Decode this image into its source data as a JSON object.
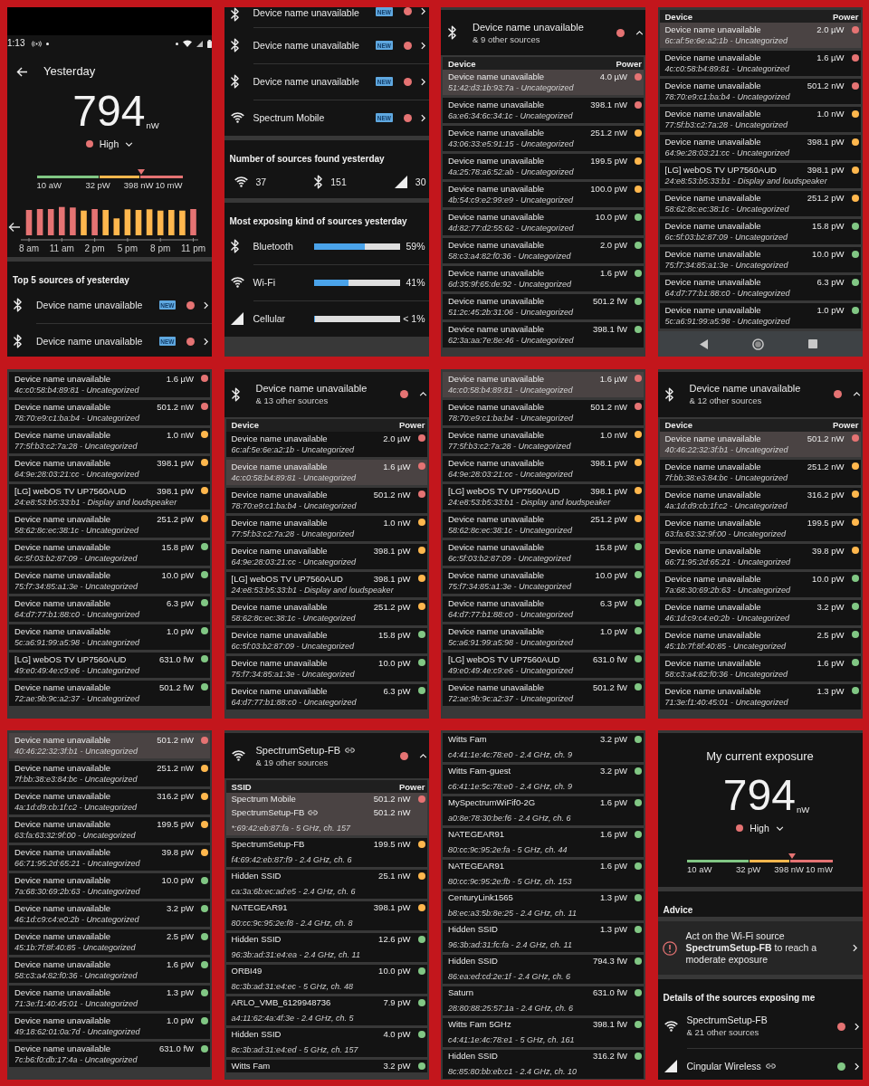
{
  "screens": [
    {
      "blocks": [
        {
          "kind": "status_bar",
          "time": "1:13"
        },
        {
          "kind": "title_bar",
          "title": "Yesterday"
        },
        {
          "kind": "reading",
          "value": "794",
          "unit": "nW",
          "rating": "High",
          "color": "#e57373"
        },
        {
          "kind": "scale",
          "level": 0.72,
          "labels": [
            "10 aW",
            "32 pW",
            "398 nW",
            "10 mW"
          ]
        },
        {
          "kind": "hourly_chart",
          "x_labels": [
            "8 am",
            "11 am",
            "2 pm",
            "5 pm",
            "8 pm",
            "11 pm"
          ]
        },
        {
          "kind": "section_title",
          "text": "Top 5 sources of yesterday"
        },
        {
          "kind": "bluetooth_row",
          "name": "Device name unavailable",
          "badge": "NEW",
          "color": "#e57373"
        },
        {
          "kind": "bluetooth_row",
          "name": "Device name unavailable",
          "badge": "NEW",
          "color": "#e57373"
        }
      ]
    },
    {
      "blocks": [
        {
          "kind": "bluetooth_row",
          "name": "Device name unavailable",
          "badge": "NEW",
          "color": "#e57373"
        },
        {
          "kind": "bluetooth_row",
          "name": "Device name unavailable",
          "badge": "NEW",
          "color": "#e57373"
        },
        {
          "kind": "bluetooth_row",
          "name": "Device name unavailable",
          "badge": "NEW",
          "color": "#e57373"
        },
        {
          "kind": "wifi_row",
          "name": "Spectrum Mobile",
          "badge": "NEW",
          "color": "#e57373"
        },
        {
          "kind": "section_title",
          "text": "Number of sources found yesterday"
        },
        {
          "kind": "counts",
          "items": [
            {
              "kind": "wifi",
              "count": "37"
            },
            {
              "kind": "bluetooth",
              "count": "151"
            },
            {
              "kind": "cellular",
              "count": "30"
            }
          ]
        },
        {
          "kind": "section_title",
          "text": "Most exposing kind of sources yesterday"
        },
        {
          "kind": "bluetooth_share",
          "label": "Bluetooth",
          "level": 0.59,
          "reading": "59%"
        },
        {
          "kind": "wifi_share",
          "label": "Wi-Fi",
          "level": 0.41,
          "reading": "41%"
        },
        {
          "kind": "cellular_share",
          "label": "Cellular",
          "level": 0.01,
          "reading": "< 1%"
        }
      ]
    },
    {
      "blocks": [
        {
          "kind": "bluetooth_group",
          "name": "Device name unavailable",
          "subtitle": "& 9 other sources",
          "color": "#e57373",
          "expanded": true
        },
        {
          "kind": "table_header",
          "columns": [
            "Device",
            "Power"
          ]
        },
        {
          "kind": "device_row",
          "name": "Device name unavailable",
          "power": "4.0 µW",
          "color": "#e57373",
          "detail": "51:42:d3:1b:93:7a - Uncategorized",
          "selected": true
        },
        {
          "kind": "device_row",
          "name": "Device name unavailable",
          "power": "398.1 nW",
          "color": "#e57373",
          "detail": "6a:e6:34:6c:34:1c - Uncategorized",
          "selected": false
        },
        {
          "kind": "device_row",
          "name": "Device name unavailable",
          "power": "251.2 nW",
          "color": "#ffb74d",
          "detail": "43:06:33:e5:91:15 - Uncategorized",
          "selected": false
        },
        {
          "kind": "device_row",
          "name": "Device name unavailable",
          "power": "199.5 pW",
          "color": "#ffb74d",
          "detail": "4a:25:78:a6:52:ab - Uncategorized",
          "selected": false
        },
        {
          "kind": "device_row",
          "name": "Device name unavailable",
          "power": "100.0 pW",
          "color": "#ffb74d",
          "detail": "4b:54:c9:e2:99:e9 - Uncategorized",
          "selected": false
        },
        {
          "kind": "device_row",
          "name": "Device name unavailable",
          "power": "10.0 pW",
          "color": "#81c784",
          "detail": "4d:82:77:d2:55:62 - Uncategorized",
          "selected": false
        },
        {
          "kind": "device_row",
          "name": "Device name unavailable",
          "power": "2.0 pW",
          "color": "#81c784",
          "detail": "58:c3:a4:82:f0:36 - Uncategorized",
          "selected": false
        },
        {
          "kind": "device_row",
          "name": "Device name unavailable",
          "power": "1.6 pW",
          "color": "#81c784",
          "detail": "6d:35:9f:65:de:92 - Uncategorized",
          "selected": false
        },
        {
          "kind": "device_row",
          "name": "Device name unavailable",
          "power": "501.2 fW",
          "color": "#81c784",
          "detail": "51:2c:45:2b:31:06 - Uncategorized",
          "selected": false
        },
        {
          "kind": "device_row",
          "name": "Device name unavailable",
          "power": "398.1 fW",
          "color": "#81c784",
          "detail": "62:3a:aa:7e:8e:46 - Uncategorized",
          "selected": false
        }
      ]
    },
    {
      "blocks": [
        {
          "kind": "table_header",
          "columns": [
            "Device",
            "Power"
          ]
        },
        {
          "kind": "device_row",
          "name": "Device name unavailable",
          "power": "2.0 µW",
          "color": "#e57373",
          "detail": "6c:af:5e:6e:a2:1b - Uncategorized",
          "selected": true
        },
        {
          "kind": "device_row",
          "name": "Device name unavailable",
          "power": "1.6 µW",
          "color": "#e57373",
          "detail": "4c:c0:58:b4:89:81 - Uncategorized",
          "selected": false
        },
        {
          "kind": "device_row",
          "name": "Device name unavailable",
          "power": "501.2 nW",
          "color": "#e57373",
          "detail": "78:70:e9:c1:ba:b4 - Uncategorized",
          "selected": false
        },
        {
          "kind": "device_row",
          "name": "Device name unavailable",
          "power": "1.0 nW",
          "color": "#ffb74d",
          "detail": "77:5f:b3:c2:7a:28 - Uncategorized",
          "selected": false
        },
        {
          "kind": "device_row",
          "name": "Device name unavailable",
          "power": "398.1 pW",
          "color": "#ffb74d",
          "detail": "64:9e:28:03:21:cc - Uncategorized",
          "selected": false
        },
        {
          "kind": "device_row",
          "name": "[LG] webOS TV UP7560AUD",
          "power": "398.1 pW",
          "color": "#ffb74d",
          "detail": "24:e8:53:b5:33:b1 - Display and loudspeaker",
          "selected": false
        },
        {
          "kind": "device_row",
          "name": "Device name unavailable",
          "power": "251.2 pW",
          "color": "#ffb74d",
          "detail": "58:62:8c:ec:38:1c - Uncategorized",
          "selected": false
        },
        {
          "kind": "device_row",
          "name": "Device name unavailable",
          "power": "15.8 pW",
          "color": "#81c784",
          "detail": "6c:5f:03:b2:87:09 - Uncategorized",
          "selected": false
        },
        {
          "kind": "device_row",
          "name": "Device name unavailable",
          "power": "10.0 pW",
          "color": "#81c784",
          "detail": "75:f7:34:85:a1:3e - Uncategorized",
          "selected": false
        },
        {
          "kind": "device_row",
          "name": "Device name unavailable",
          "power": "6.3 pW",
          "color": "#81c784",
          "detail": "64:d7:77:b1:88:c0 - Uncategorized",
          "selected": false
        },
        {
          "kind": "device_row",
          "name": "Device name unavailable",
          "power": "1.0 pW",
          "color": "#81c784",
          "detail": "5c:a6:91:99:a5:98 - Uncategorized",
          "selected": false
        },
        {
          "kind": "nav_bar"
        }
      ]
    },
    {
      "blocks": [
        {
          "kind": "device_row",
          "name": "Device name unavailable",
          "power": "1.6 µW",
          "color": "#e57373",
          "detail": "4c:c0:58:b4:89:81 - Uncategorized",
          "selected": false
        },
        {
          "kind": "device_row",
          "name": "Device name unavailable",
          "power": "501.2 nW",
          "color": "#e57373",
          "detail": "78:70:e9:c1:ba:b4 - Uncategorized",
          "selected": false
        },
        {
          "kind": "device_row",
          "name": "Device name unavailable",
          "power": "1.0 nW",
          "color": "#ffb74d",
          "detail": "77:5f:b3:c2:7a:28 - Uncategorized",
          "selected": false
        },
        {
          "kind": "device_row",
          "name": "Device name unavailable",
          "power": "398.1 pW",
          "color": "#ffb74d",
          "detail": "64:9e:28:03:21:cc - Uncategorized",
          "selected": false
        },
        {
          "kind": "device_row",
          "name": "[LG] webOS TV UP7560AUD",
          "power": "398.1 pW",
          "color": "#ffb74d",
          "detail": "24:e8:53:b5:33:b1 - Display and loudspeaker",
          "selected": false
        },
        {
          "kind": "device_row",
          "name": "Device name unavailable",
          "power": "251.2 pW",
          "color": "#ffb74d",
          "detail": "58:62:8c:ec:38:1c - Uncategorized",
          "selected": false
        },
        {
          "kind": "device_row",
          "name": "Device name unavailable",
          "power": "15.8 pW",
          "color": "#81c784",
          "detail": "6c:5f:03:b2:87:09 - Uncategorized",
          "selected": false
        },
        {
          "kind": "device_row",
          "name": "Device name unavailable",
          "power": "10.0 pW",
          "color": "#81c784",
          "detail": "75:f7:34:85:a1:3e - Uncategorized",
          "selected": false
        },
        {
          "kind": "device_row",
          "name": "Device name unavailable",
          "power": "6.3 pW",
          "color": "#81c784",
          "detail": "64:d7:77:b1:88:c0 - Uncategorized",
          "selected": false
        },
        {
          "kind": "device_row",
          "name": "Device name unavailable",
          "power": "1.0 pW",
          "color": "#81c784",
          "detail": "5c:a6:91:99:a5:98 - Uncategorized",
          "selected": false
        },
        {
          "kind": "device_row",
          "name": "[LG] webOS TV UP7560AUD",
          "power": "631.0 fW",
          "color": "#81c784",
          "detail": "49:e0:49:4e:c9:e6 - Uncategorized",
          "selected": false
        },
        {
          "kind": "device_row",
          "name": "Device name unavailable",
          "power": "501.2 fW",
          "color": "#81c784",
          "detail": "72:ae:9b:9c:a2:37 - Uncategorized",
          "selected": false
        }
      ]
    },
    {
      "blocks": [
        {
          "kind": "bluetooth_group",
          "name": "Device name unavailable",
          "subtitle": "& 13 other sources",
          "color": "#e57373",
          "expanded": true
        },
        {
          "kind": "table_header",
          "columns": [
            "Device",
            "Power"
          ]
        },
        {
          "kind": "device_row",
          "name": "Device name unavailable",
          "power": "2.0 µW",
          "color": "#e57373",
          "detail": "6c:af:5e:6e:a2:1b - Uncategorized",
          "selected": false
        },
        {
          "kind": "device_row",
          "name": "Device name unavailable",
          "power": "1.6 µW",
          "color": "#e57373",
          "detail": "4c:c0:58:b4:89:81 - Uncategorized",
          "selected": true
        },
        {
          "kind": "device_row",
          "name": "Device name unavailable",
          "power": "501.2 nW",
          "color": "#e57373",
          "detail": "78:70:e9:c1:ba:b4 - Uncategorized",
          "selected": false
        },
        {
          "kind": "device_row",
          "name": "Device name unavailable",
          "power": "1.0 nW",
          "color": "#ffb74d",
          "detail": "77:5f:b3:c2:7a:28 - Uncategorized",
          "selected": false
        },
        {
          "kind": "device_row",
          "name": "Device name unavailable",
          "power": "398.1 pW",
          "color": "#ffb74d",
          "detail": "64:9e:28:03:21:cc - Uncategorized",
          "selected": false
        },
        {
          "kind": "device_row",
          "name": "[LG] webOS TV UP7560AUD",
          "power": "398.1 pW",
          "color": "#ffb74d",
          "detail": "24:e8:53:b5:33:b1 - Display and loudspeaker",
          "selected": false
        },
        {
          "kind": "device_row",
          "name": "Device name unavailable",
          "power": "251.2 pW",
          "color": "#ffb74d",
          "detail": "58:62:8c:ec:38:1c - Uncategorized",
          "selected": false
        },
        {
          "kind": "device_row",
          "name": "Device name unavailable",
          "power": "15.8 pW",
          "color": "#81c784",
          "detail": "6c:5f:03:b2:87:09 - Uncategorized",
          "selected": false
        },
        {
          "kind": "device_row",
          "name": "Device name unavailable",
          "power": "10.0 pW",
          "color": "#81c784",
          "detail": "75:f7:34:85:a1:3e - Uncategorized",
          "selected": false
        },
        {
          "kind": "device_row",
          "name": "Device name unavailable",
          "power": "6.3 pW",
          "color": "#81c784",
          "detail": "64:d7:77:b1:88:c0 - Uncategorized",
          "selected": false
        }
      ]
    },
    {
      "blocks": [
        {
          "kind": "device_row",
          "name": "Device name unavailable",
          "power": "1.6 µW",
          "color": "#e57373",
          "detail": "4c:c0:58:b4:89:81 - Uncategorized",
          "selected": true
        },
        {
          "kind": "device_row",
          "name": "Device name unavailable",
          "power": "501.2 nW",
          "color": "#e57373",
          "detail": "78:70:e9:c1:ba:b4 - Uncategorized",
          "selected": false
        },
        {
          "kind": "device_row",
          "name": "Device name unavailable",
          "power": "1.0 nW",
          "color": "#ffb74d",
          "detail": "77:5f:b3:c2:7a:28 - Uncategorized",
          "selected": false
        },
        {
          "kind": "device_row",
          "name": "Device name unavailable",
          "power": "398.1 pW",
          "color": "#ffb74d",
          "detail": "64:9e:28:03:21:cc - Uncategorized",
          "selected": false
        },
        {
          "kind": "device_row",
          "name": "[LG] webOS TV UP7560AUD",
          "power": "398.1 pW",
          "color": "#ffb74d",
          "detail": "24:e8:53:b5:33:b1 - Display and loudspeaker",
          "selected": false
        },
        {
          "kind": "device_row",
          "name": "Device name unavailable",
          "power": "251.2 pW",
          "color": "#ffb74d",
          "detail": "58:62:8c:ec:38:1c - Uncategorized",
          "selected": false
        },
        {
          "kind": "device_row",
          "name": "Device name unavailable",
          "power": "15.8 pW",
          "color": "#81c784",
          "detail": "6c:5f:03:b2:87:09 - Uncategorized",
          "selected": false
        },
        {
          "kind": "device_row",
          "name": "Device name unavailable",
          "power": "10.0 pW",
          "color": "#81c784",
          "detail": "75:f7:34:85:a1:3e - Uncategorized",
          "selected": false
        },
        {
          "kind": "device_row",
          "name": "Device name unavailable",
          "power": "6.3 pW",
          "color": "#81c784",
          "detail": "64:d7:77:b1:88:c0 - Uncategorized",
          "selected": false
        },
        {
          "kind": "device_row",
          "name": "Device name unavailable",
          "power": "1.0 pW",
          "color": "#81c784",
          "detail": "5c:a6:91:99:a5:98 - Uncategorized",
          "selected": false
        },
        {
          "kind": "device_row",
          "name": "[LG] webOS TV UP7560AUD",
          "power": "631.0 fW",
          "color": "#81c784",
          "detail": "49:e0:49:4e:c9:e6 - Uncategorized",
          "selected": false
        },
        {
          "kind": "device_row",
          "name": "Device name unavailable",
          "power": "501.2 fW",
          "color": "#81c784",
          "detail": "72:ae:9b:9c:a2:37 - Uncategorized",
          "selected": false
        }
      ]
    },
    {
      "blocks": [
        {
          "kind": "bluetooth_group",
          "name": "Device name unavailable",
          "subtitle": "& 12 other sources",
          "color": "#e57373",
          "expanded": true
        },
        {
          "kind": "table_header",
          "columns": [
            "Device",
            "Power"
          ]
        },
        {
          "kind": "device_row",
          "name": "Device name unavailable",
          "power": "501.2 nW",
          "color": "#e57373",
          "detail": "40:46:22:32:3f:b1 - Uncategorized",
          "selected": true
        },
        {
          "kind": "device_row",
          "name": "Device name unavailable",
          "power": "251.2 nW",
          "color": "#ffb74d",
          "detail": "7f:bb:38:e3:84:bc - Uncategorized",
          "selected": false
        },
        {
          "kind": "device_row",
          "name": "Device name unavailable",
          "power": "316.2 pW",
          "color": "#ffb74d",
          "detail": "4a:1d:d9:cb:1f:c2 - Uncategorized",
          "selected": false
        },
        {
          "kind": "device_row",
          "name": "Device name unavailable",
          "power": "199.5 pW",
          "color": "#ffb74d",
          "detail": "63:fa:63:32:9f:00 - Uncategorized",
          "selected": false
        },
        {
          "kind": "device_row",
          "name": "Device name unavailable",
          "power": "39.8 pW",
          "color": "#ffb74d",
          "detail": "66:71:95:2d:65:21 - Uncategorized",
          "selected": false
        },
        {
          "kind": "device_row",
          "name": "Device name unavailable",
          "power": "10.0 pW",
          "color": "#81c784",
          "detail": "7a:68:30:69:2b:63 - Uncategorized",
          "selected": false
        },
        {
          "kind": "device_row",
          "name": "Device name unavailable",
          "power": "3.2 pW",
          "color": "#81c784",
          "detail": "46:1d:c9:c4:e0:2b - Uncategorized",
          "selected": false
        },
        {
          "kind": "device_row",
          "name": "Device name unavailable",
          "power": "2.5 pW",
          "color": "#81c784",
          "detail": "45:1b:7f:8f:40:85 - Uncategorized",
          "selected": false
        },
        {
          "kind": "device_row",
          "name": "Device name unavailable",
          "power": "1.6 pW",
          "color": "#81c784",
          "detail": "58:c3:a4:82:f0:36 - Uncategorized",
          "selected": false
        },
        {
          "kind": "device_row",
          "name": "Device name unavailable",
          "power": "1.3 pW",
          "color": "#81c784",
          "detail": "71:3e:f1:40:45:01 - Uncategorized",
          "selected": false
        }
      ]
    },
    {
      "blocks": [
        {
          "kind": "device_row",
          "name": "Device name unavailable",
          "power": "501.2 nW",
          "color": "#e57373",
          "detail": "40:46:22:32:3f:b1 - Uncategorized",
          "selected": true
        },
        {
          "kind": "device_row",
          "name": "Device name unavailable",
          "power": "251.2 nW",
          "color": "#ffb74d",
          "detail": "7f:bb:38:e3:84:bc - Uncategorized",
          "selected": false
        },
        {
          "kind": "device_row",
          "name": "Device name unavailable",
          "power": "316.2 pW",
          "color": "#ffb74d",
          "detail": "4a:1d:d9:cb:1f:c2 - Uncategorized",
          "selected": false
        },
        {
          "kind": "device_row",
          "name": "Device name unavailable",
          "power": "199.5 pW",
          "color": "#ffb74d",
          "detail": "63:fa:63:32:9f:00 - Uncategorized",
          "selected": false
        },
        {
          "kind": "device_row",
          "name": "Device name unavailable",
          "power": "39.8 pW",
          "color": "#ffb74d",
          "detail": "66:71:95:2d:65:21 - Uncategorized",
          "selected": false
        },
        {
          "kind": "device_row",
          "name": "Device name unavailable",
          "power": "10.0 pW",
          "color": "#81c784",
          "detail": "7a:68:30:69:2b:63 - Uncategorized",
          "selected": false
        },
        {
          "kind": "device_row",
          "name": "Device name unavailable",
          "power": "3.2 pW",
          "color": "#81c784",
          "detail": "46:1d:c9:c4:e0:2b - Uncategorized",
          "selected": false
        },
        {
          "kind": "device_row",
          "name": "Device name unavailable",
          "power": "2.5 pW",
          "color": "#81c784",
          "detail": "45:1b:7f:8f:40:85 - Uncategorized",
          "selected": false
        },
        {
          "kind": "device_row",
          "name": "Device name unavailable",
          "power": "1.6 pW",
          "color": "#81c784",
          "detail": "58:c3:a4:82:f0:36 - Uncategorized",
          "selected": false
        },
        {
          "kind": "device_row",
          "name": "Device name unavailable",
          "power": "1.3 pW",
          "color": "#81c784",
          "detail": "71:3e:f1:40:45:01 - Uncategorized",
          "selected": false
        },
        {
          "kind": "device_row",
          "name": "Device name unavailable",
          "power": "1.0 pW",
          "color": "#81c784",
          "detail": "49:18:62:01:0a:7d - Uncategorized",
          "selected": false
        },
        {
          "kind": "device_row",
          "name": "Device name unavailable",
          "power": "631.0 fW",
          "color": "#81c784",
          "detail": "7c:b6:f0:db:17:4a - Uncategorized",
          "selected": false
        }
      ]
    },
    {
      "blocks": [
        {
          "kind": "wifi_group",
          "name": "SpectrumSetup-FB",
          "link": true,
          "subtitle": "& 19 other sources",
          "color": "#e57373",
          "expanded": true
        },
        {
          "kind": "table_header",
          "columns": [
            "SSID",
            "Power"
          ]
        },
        {
          "kind": "network_row",
          "name": "Spectrum Mobile",
          "power": "501.2 nW",
          "color": "#e57373",
          "also": [
            {
              "name": "SpectrumSetup-FB",
              "power": "501.2 nW",
              "link": true
            }
          ],
          "detail": "*:69:42:eb:87:fa - 5 GHz, ch. 157",
          "selected": true
        },
        {
          "kind": "network_row",
          "name": "SpectrumSetup-FB",
          "power": "199.5 nW",
          "color": "#ffb74d",
          "detail": "f4:69:42:eb:87:f9 - 2.4 GHz, ch. 6",
          "selected": false
        },
        {
          "kind": "network_row",
          "name": "Hidden SSID",
          "power": "25.1 nW",
          "color": "#ffb74d",
          "detail": "ca:3a:6b:ec:ad:e5 - 2.4 GHz, ch. 6",
          "selected": false
        },
        {
          "kind": "network_row",
          "name": "NATEGEAR91",
          "power": "398.1 pW",
          "color": "#ffb74d",
          "detail": "80:cc:9c:95:2e:f8 - 2.4 GHz, ch. 8",
          "selected": false
        },
        {
          "kind": "network_row",
          "name": "Hidden SSID",
          "power": "12.6 pW",
          "color": "#81c784",
          "detail": "96:3b:ad:31:e4:ea - 2.4 GHz, ch. 11",
          "selected": false
        },
        {
          "kind": "network_row",
          "name": "ORBI49",
          "power": "10.0 pW",
          "color": "#81c784",
          "detail": "8c:3b:ad:31:e4:ec - 5 GHz, ch. 48",
          "selected": false
        },
        {
          "kind": "network_row",
          "name": "ARLO_VMB_6129948736",
          "power": "7.9 pW",
          "color": "#81c784",
          "detail": "a4:11:62:4a:4f:3e - 2.4 GHz, ch. 5",
          "selected": false
        },
        {
          "kind": "network_row",
          "name": "Hidden SSID",
          "power": "4.0 pW",
          "color": "#81c784",
          "detail": "8c:3b:ad:31:e4:ed - 5 GHz, ch. 157",
          "selected": false
        },
        {
          "kind": "network_row",
          "name": "Witts Fam",
          "power": "3.2 pW",
          "color": "#81c784",
          "selected": false
        }
      ]
    },
    {
      "blocks": [
        {
          "kind": "network_row",
          "name": "Witts Fam",
          "power": "3.2 pW",
          "color": "#81c784",
          "detail": "c4:41:1e:4c:78:e0 - 2.4 GHz, ch. 9",
          "selected": false
        },
        {
          "kind": "network_row",
          "name": "Witts Fam-guest",
          "power": "3.2 pW",
          "color": "#81c784",
          "detail": "c6:41:1e:5c:78:e0 - 2.4 GHz, ch. 9",
          "selected": false
        },
        {
          "kind": "network_row",
          "name": "MySpectrumWiFif0-2G",
          "power": "1.6 pW",
          "color": "#81c784",
          "detail": "a0:8e:78:30:be:f6 - 2.4 GHz, ch. 6",
          "selected": false
        },
        {
          "kind": "network_row",
          "name": "NATEGEAR91",
          "power": "1.6 pW",
          "color": "#81c784",
          "detail": "80:cc:9c:95:2e:fa - 5 GHz, ch. 44",
          "selected": false
        },
        {
          "kind": "network_row",
          "name": "NATEGEAR91",
          "power": "1.6 pW",
          "color": "#81c784",
          "detail": "80:cc:9c:95:2e:fb - 5 GHz, ch. 153",
          "selected": false
        },
        {
          "kind": "network_row",
          "name": "CenturyLink1565",
          "power": "1.3 pW",
          "color": "#81c784",
          "detail": "b8:ec:a3:5b:8e:25 - 2.4 GHz, ch. 11",
          "selected": false
        },
        {
          "kind": "network_row",
          "name": "Hidden SSID",
          "power": "1.3 pW",
          "color": "#81c784",
          "detail": "96:3b:ad:31:fc:fa - 2.4 GHz, ch. 11",
          "selected": false
        },
        {
          "kind": "network_row",
          "name": "Hidden SSID",
          "power": "794.3 fW",
          "color": "#81c784",
          "detail": "86:ea:ed:cd:2e:1f - 2.4 GHz, ch. 6",
          "selected": false
        },
        {
          "kind": "network_row",
          "name": "Saturn",
          "power": "631.0 fW",
          "color": "#81c784",
          "detail": "28:80:88:25:57:1a - 2.4 GHz, ch. 6",
          "selected": false
        },
        {
          "kind": "network_row",
          "name": "Witts Fam 5GHz",
          "power": "398.1 fW",
          "color": "#81c784",
          "detail": "c4:41:1e:4c:78:e1 - 5 GHz, ch. 161",
          "selected": false
        },
        {
          "kind": "network_row",
          "name": "Hidden SSID",
          "power": "316.2 fW",
          "color": "#81c784",
          "detail": "8c:85:80:bb:eb:c1 - 2.4 GHz, ch. 10",
          "selected": false
        }
      ]
    },
    {
      "blocks": [
        {
          "kind": "reading",
          "heading": "My current exposure",
          "value": "794",
          "unit": "nW",
          "rating": "High",
          "color": "#e57373"
        },
        {
          "kind": "scale",
          "level": 0.72,
          "labels": [
            "10 aW",
            "32 pW",
            "398 nW",
            "10 mW"
          ]
        },
        {
          "kind": "section_title",
          "text": "Advice"
        },
        {
          "kind": "advice",
          "text": "Act on the Wi-Fi source **SpectrumSetup-FB** to reach a moderate exposure"
        },
        {
          "kind": "section_title",
          "text": "Details of the sources exposing me"
        },
        {
          "kind": "wifi_row",
          "name": "SpectrumSetup-FB",
          "subtitle": "& 21 other sources",
          "color": "#e57373"
        },
        {
          "kind": "cellular_row",
          "name": "Cingular Wireless",
          "link": true,
          "color": "#81c784"
        }
      ]
    }
  ]
}
